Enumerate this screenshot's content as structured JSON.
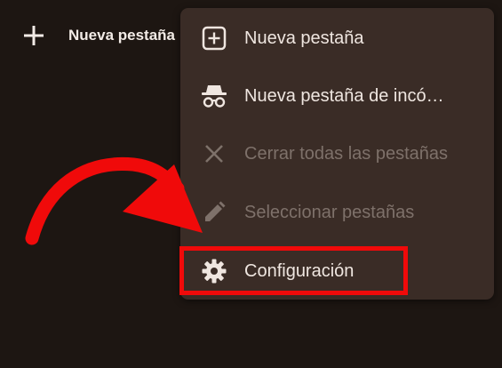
{
  "topbar": {
    "new_tab_label": "Nueva pestaña"
  },
  "menu": {
    "items": [
      {
        "label": "Nueva pestaña",
        "icon": "add-box-icon",
        "enabled": true
      },
      {
        "label": "Nueva pestaña de incó…",
        "icon": "incognito-icon",
        "enabled": true
      },
      {
        "label": "Cerrar todas las pestañas",
        "icon": "close-icon",
        "enabled": false
      },
      {
        "label": "Seleccionar pestañas",
        "icon": "pencil-icon",
        "enabled": false
      },
      {
        "label": "Configuración",
        "icon": "gear-icon",
        "enabled": true,
        "highlighted": true
      }
    ]
  },
  "colors": {
    "background": "#1d1612",
    "menu_background": "#3a2c26",
    "text": "#efe6e0",
    "disabled_text": "#7e716a",
    "annotation_red": "#f00a0a"
  }
}
